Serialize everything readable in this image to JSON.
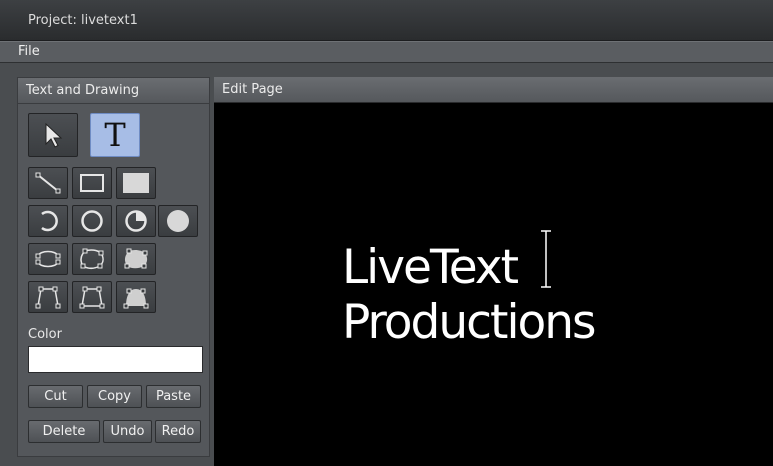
{
  "window": {
    "title": "Project: livetext1"
  },
  "menu": {
    "file": "File"
  },
  "left_panel": {
    "title": "Text and Drawing",
    "color_label": "Color",
    "color_value": "#ffffff",
    "buttons": {
      "cut": "Cut",
      "copy": "Copy",
      "paste": "Paste",
      "delete": "Delete",
      "undo": "Undo",
      "redo": "Redo"
    },
    "tools": {
      "text_glyph": "T",
      "active_tool": "text"
    }
  },
  "edit_panel": {
    "title": "Edit Page",
    "line1": "LiveText",
    "line2": "Productions"
  },
  "colors": {
    "active_tool_bg": "#a7bde6",
    "canvas_bg": "#000000"
  }
}
